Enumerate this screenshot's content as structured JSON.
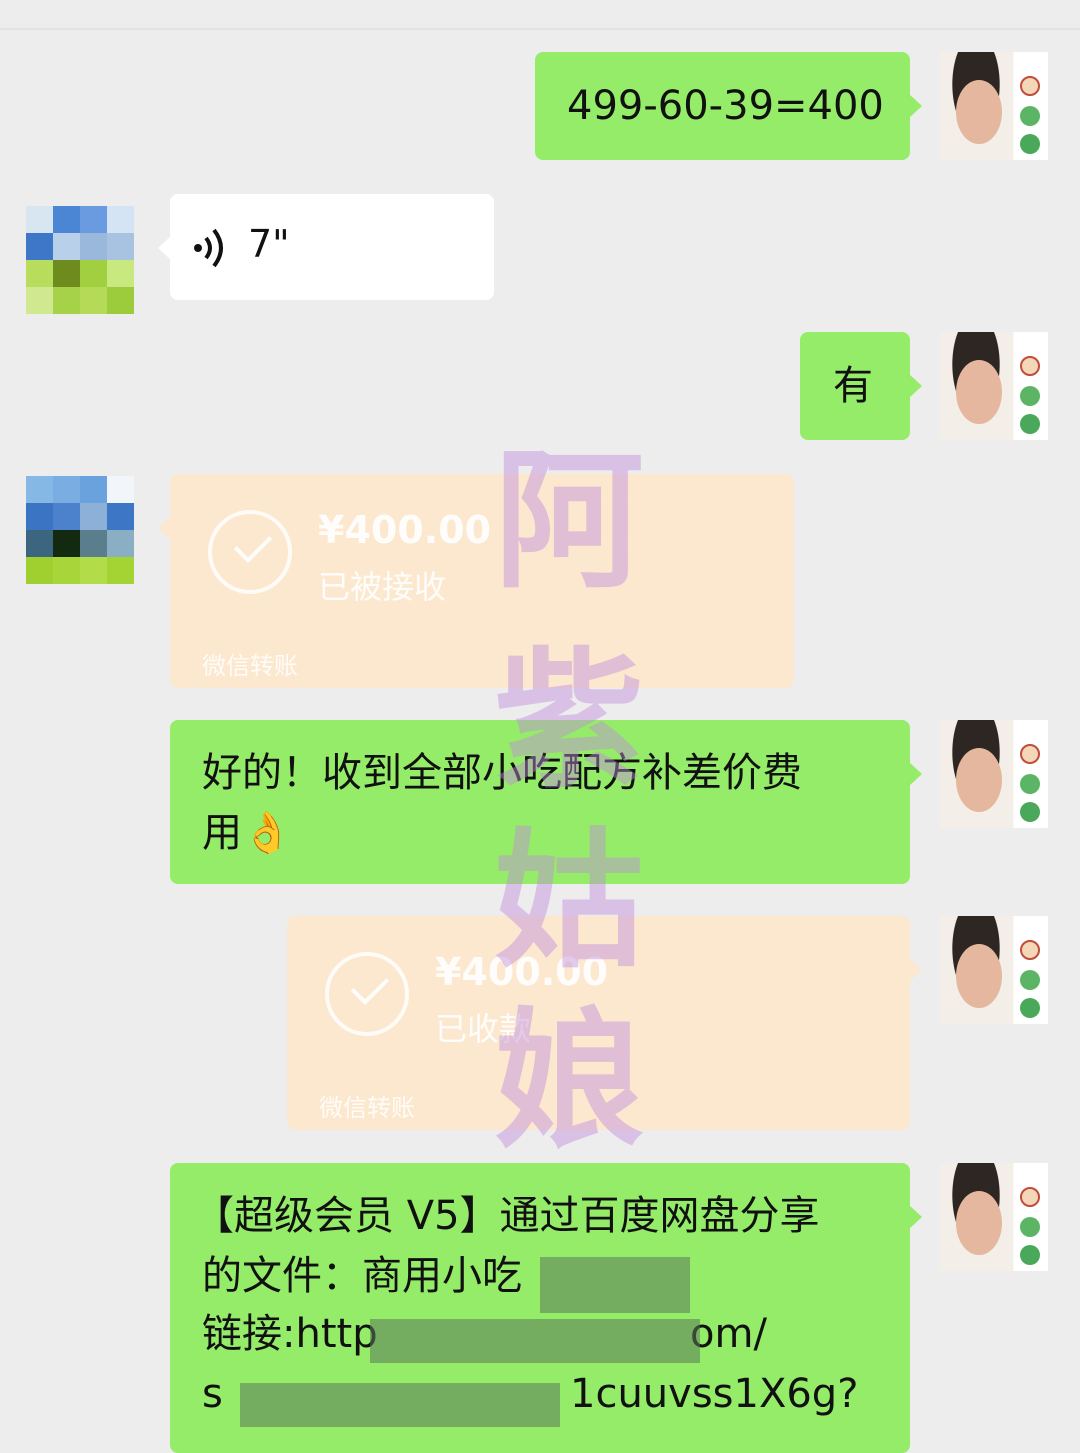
{
  "chat": {
    "messages": {
      "m1": {
        "text": "499-60-39=400"
      },
      "m2": {
        "voice_duration": "7\""
      },
      "m3": {
        "text": "有"
      },
      "m4": {
        "amount": "¥400.00",
        "status": "已被接收",
        "footer": "微信转账"
      },
      "m5": {
        "line1": "好的！收到全部小吃配方补差价费",
        "line2": "用👌"
      },
      "m6": {
        "amount": "¥400.00",
        "status": "已收款",
        "footer": "微信转账"
      },
      "m7": {
        "line1": "【超级会员 V5】通过百度网盘分享",
        "line2": "的文件：商用小吃",
        "line3_start": "链接:http",
        "line3_end": "om/",
        "line4_start": "s",
        "line4_end": "1cuuvss1X6g?"
      }
    }
  },
  "watermark": {
    "chars": [
      "阿",
      "紫",
      "姑",
      "娘"
    ]
  },
  "colors": {
    "outgoing_bubble": "#95ec69",
    "incoming_bubble": "#ffffff",
    "transfer_card": "#fce8cf",
    "background": "#ededed"
  },
  "icons": {
    "voice": "voice-wave-icon",
    "transfer": "check-circle-icon"
  }
}
